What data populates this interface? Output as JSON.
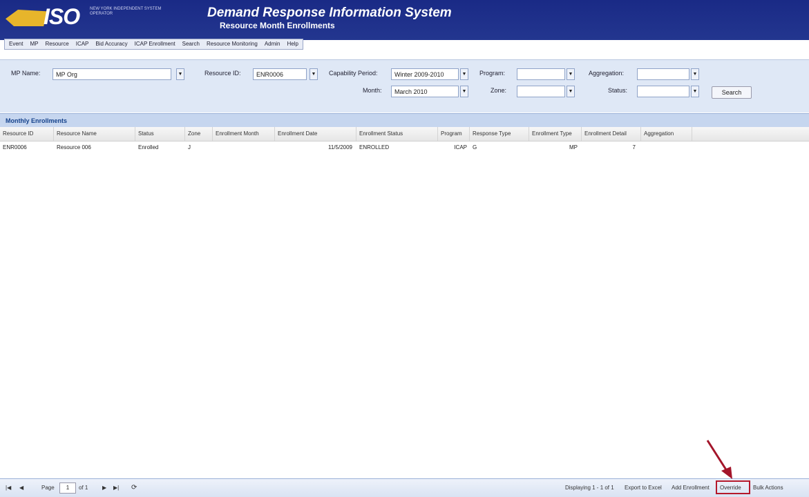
{
  "header": {
    "logo_text": "ISO",
    "logo_sub": "NEW YORK INDEPENDENT SYSTEM OPERATOR",
    "title": "Demand Response Information System",
    "subtitle": "Resource Month Enrollments"
  },
  "menu": [
    "Event",
    "MP",
    "Resource",
    "ICAP",
    "Bid Accuracy",
    "ICAP Enrollment",
    "Search",
    "Resource Monitoring",
    "Admin",
    "Help"
  ],
  "filters": {
    "mp_name_label": "MP Name:",
    "mp_name_value": "MP Org",
    "resource_id_label": "Resource ID:",
    "resource_id_value": "ENR0006",
    "capability_period_label": "Capability Period:",
    "capability_period_value": "Winter 2009-2010",
    "month_label": "Month:",
    "month_value": "March 2010",
    "program_label": "Program:",
    "program_value": "",
    "zone_label": "Zone:",
    "zone_value": "",
    "aggregation_label": "Aggregation:",
    "aggregation_value": "",
    "status_label": "Status:",
    "status_value": "",
    "search_label": "Search"
  },
  "grid": {
    "title": "Monthly Enrollments",
    "columns": [
      "Resource ID",
      "Resource Name",
      "Status",
      "Zone",
      "Enrollment Month",
      "Enrollment Date",
      "Enrollment Status",
      "Program",
      "Response Type",
      "Enrollment Type",
      "Enrollment Detail",
      "Aggregation"
    ],
    "rows": [
      [
        "ENR0006",
        "Resource 006",
        "Enrolled",
        "J",
        "",
        "11/5/2009",
        "ENROLLED",
        "ICAP",
        "G",
        "MP",
        "7",
        ""
      ]
    ]
  },
  "footer": {
    "page_label": "Page",
    "page_value": "1",
    "of_label": "of 1",
    "displaying": "Displaying 1 - 1 of 1",
    "actions": [
      "Export to Excel",
      "Add Enrollment",
      "Override",
      "Bulk Actions"
    ],
    "highlighted_action": "Override"
  },
  "colors": {
    "header_bg": "#1a2a86",
    "panel_bg": "#dfe8f6",
    "highlight": "#b5182b"
  }
}
